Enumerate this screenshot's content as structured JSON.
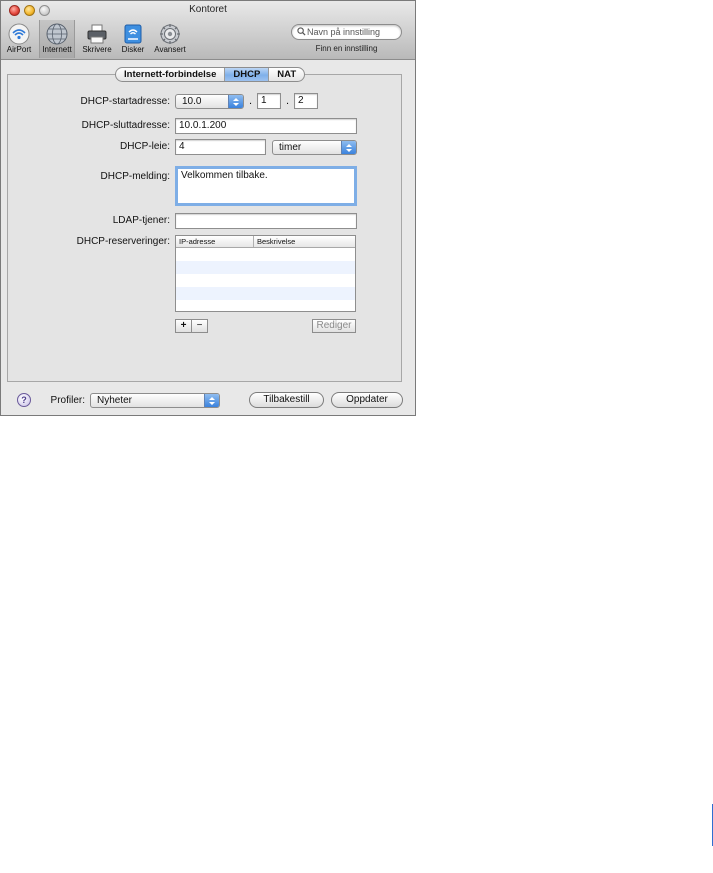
{
  "window": {
    "title": "Kontoret"
  },
  "toolbar": {
    "items": [
      {
        "label": "AirPort",
        "icon": "airport-icon"
      },
      {
        "label": "Internett",
        "icon": "globe-icon"
      },
      {
        "label": "Skrivere",
        "icon": "printer-icon"
      },
      {
        "label": "Disker",
        "icon": "disk-icon"
      },
      {
        "label": "Avansert",
        "icon": "gear-icon"
      }
    ],
    "search_placeholder": "Navn på innstilling",
    "search_caption": "Finn en innstilling"
  },
  "tabs": [
    "Internett-forbindelse",
    "DHCP",
    "NAT"
  ],
  "active_tab": "DHCP",
  "form": {
    "start_label": "DHCP-startadresse:",
    "start_prefix": "10.0",
    "start_dot1": ".",
    "start_octet3": "1",
    "start_dot2": ".",
    "start_octet4": "2",
    "end_label": "DHCP-sluttadresse:",
    "end_value": "10.0.1.200",
    "lease_label": "DHCP-leie:",
    "lease_value": "4",
    "lease_unit": "timer",
    "message_label": "DHCP-melding:",
    "message_value": "Velkommen tilbake.",
    "ldap_label": "LDAP-tjener:",
    "ldap_value": "",
    "reservations_label": "DHCP-reserveringer:",
    "table_columns": [
      "IP-adresse",
      "Beskrivelse"
    ],
    "add_label": "+",
    "remove_label": "−",
    "edit_label": "Rediger"
  },
  "footer": {
    "help_label": "?",
    "profiles_label": "Profiler:",
    "profile_value": "Nyheter",
    "reset_label": "Tilbakestill",
    "update_label": "Oppdater"
  },
  "colors": {
    "accent": "#7fb0ea",
    "focus_ring": "#7eaee6",
    "row_stripe": "#edf3fe"
  }
}
